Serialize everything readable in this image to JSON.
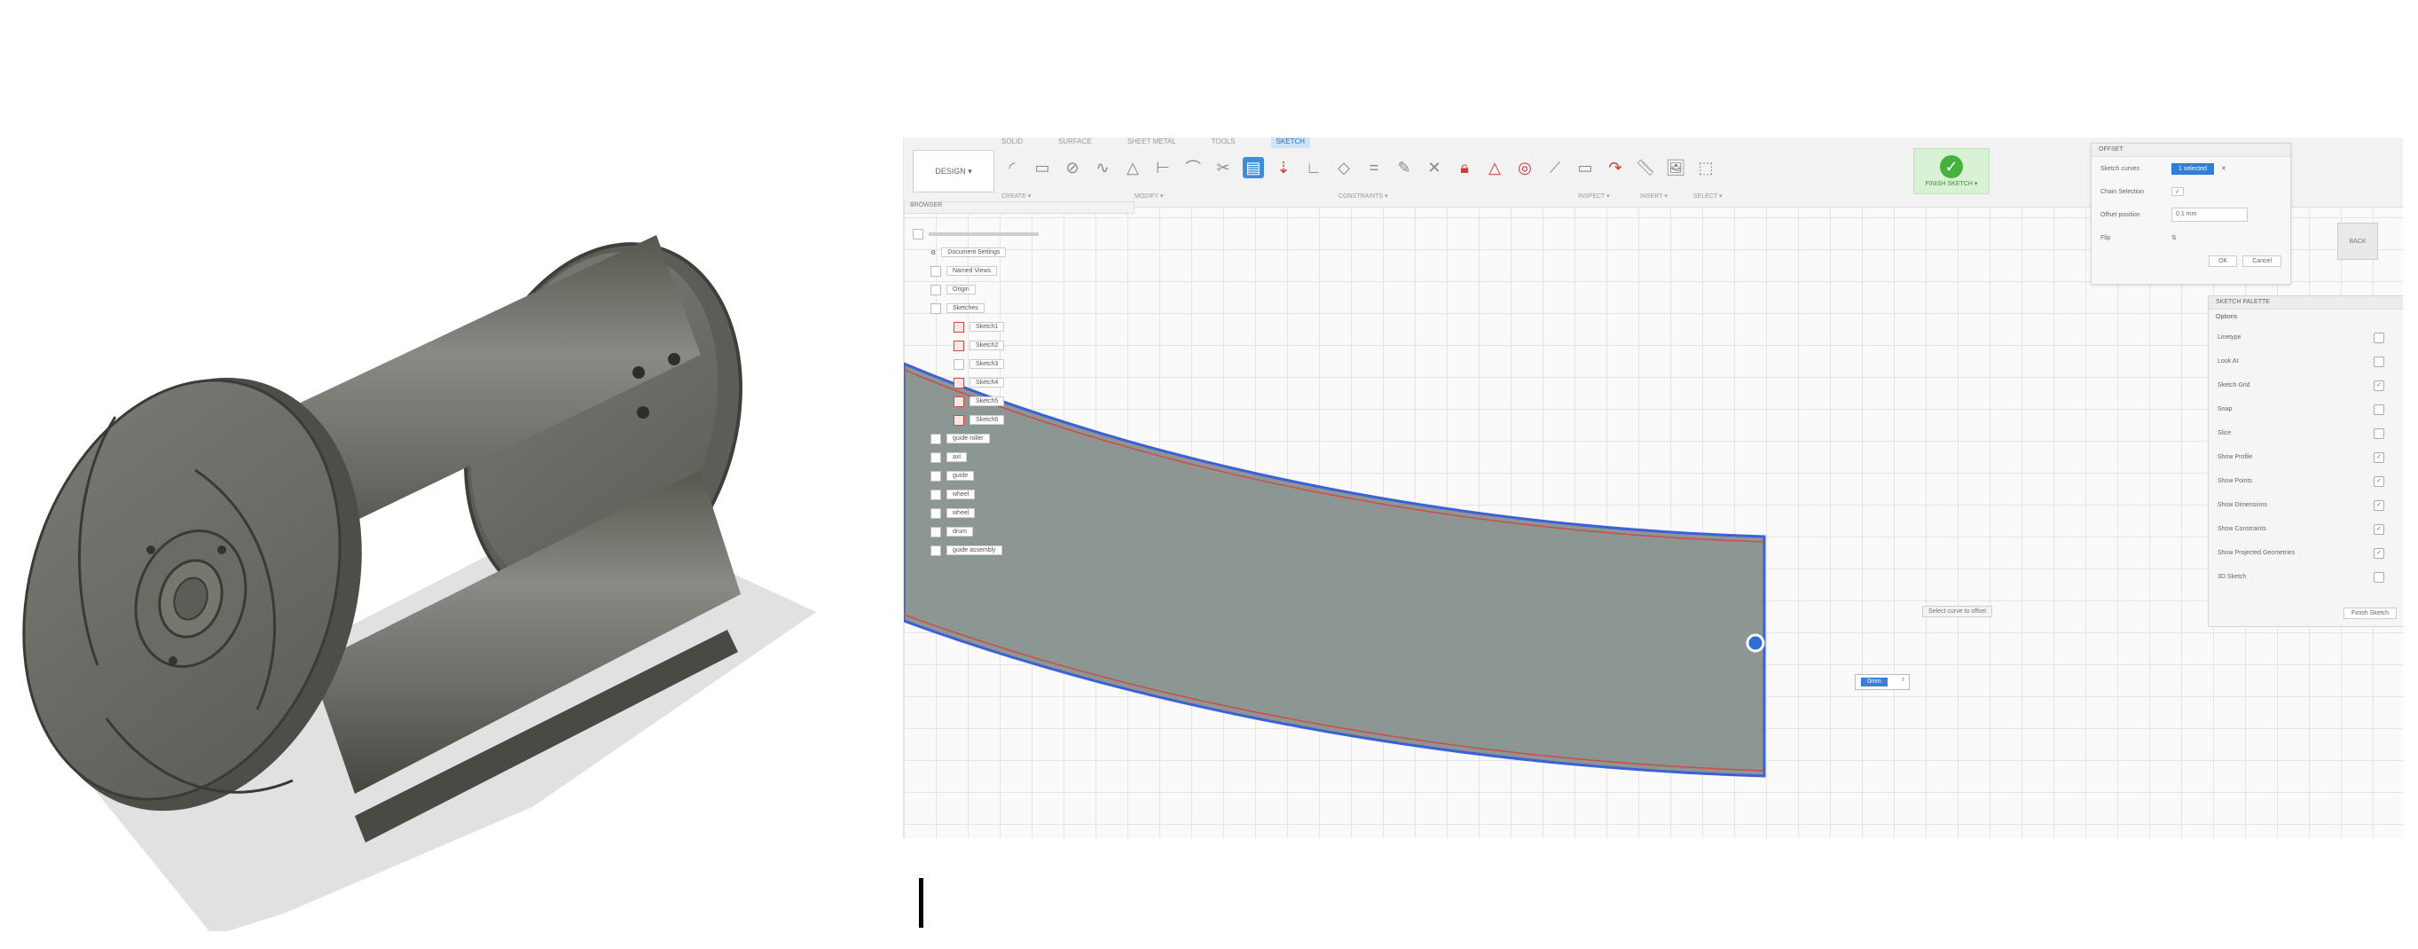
{
  "toolbar": {
    "workspace": "DESIGN ▾",
    "tabs": [
      "SOLID",
      "SURFACE",
      "SHEET METAL",
      "TOOLS",
      "SKETCH"
    ],
    "groups": [
      "CREATE ▾",
      "MODIFY ▾",
      "CONSTRAINTS ▾",
      "INSPECT ▾",
      "INSERT ▾",
      "SELECT ▾",
      "FINISH SKETCH ▾"
    ],
    "finish_label": "FINISH SKETCH ▾"
  },
  "browser": {
    "title": "BROWSER",
    "rows": [
      {
        "label": "",
        "icon": "component-icon"
      },
      {
        "label": "Document Settings",
        "icon": "gear-icon"
      },
      {
        "label": "Named Views",
        "icon": "folder-icon"
      },
      {
        "label": "Origin",
        "icon": "folder-icon"
      },
      {
        "label": "Sketches",
        "icon": "folder-icon"
      },
      {
        "label": "Sketch1",
        "icon": "sketch-icon"
      },
      {
        "label": "Sketch2",
        "icon": "sketch-icon"
      },
      {
        "label": "Sketch3",
        "icon": "sketch-icon"
      },
      {
        "label": "Sketch4",
        "icon": "sketch-icon"
      },
      {
        "label": "Sketch5",
        "icon": "sketch-icon"
      },
      {
        "label": "Sketch6",
        "icon": "sketch-icon"
      },
      {
        "label": "guide roller",
        "icon": "body-icon"
      },
      {
        "label": "axl",
        "icon": "body-icon"
      },
      {
        "label": "guide",
        "icon": "body-icon"
      },
      {
        "label": "wheel",
        "icon": "body-icon"
      },
      {
        "label": "wheel",
        "icon": "body-icon"
      },
      {
        "label": "drum",
        "icon": "body-icon"
      },
      {
        "label": "guide assembly",
        "icon": "body-icon"
      }
    ]
  },
  "offset_dialog": {
    "title": "OFFSET",
    "sketch_curves_label": "Sketch curves",
    "sketch_curves_value": "1 selected",
    "chain_selection_label": "Chain Selection",
    "offset_position_label": "Offset position",
    "offset_position_value": "0.1 mm",
    "flip_label": "Flip",
    "ok": "OK",
    "cancel": "Cancel"
  },
  "viewcube": {
    "label": "BACK"
  },
  "sketch_palette": {
    "title": "SKETCH PALETTE",
    "section": "Options",
    "options": [
      {
        "label": "Linetype",
        "checked": false
      },
      {
        "label": "Look At",
        "checked": false
      },
      {
        "label": "Sketch Grid",
        "checked": true
      },
      {
        "label": "Snap",
        "checked": false
      },
      {
        "label": "Slice",
        "checked": false
      },
      {
        "label": "Show Profile",
        "checked": true
      },
      {
        "label": "Show Points",
        "checked": true
      },
      {
        "label": "Show Dimensions",
        "checked": true
      },
      {
        "label": "Show Constraints",
        "checked": true
      },
      {
        "label": "Show Projected Geometries",
        "checked": true
      },
      {
        "label": "3D Sketch",
        "checked": false
      }
    ],
    "finish": "Finish Sketch"
  },
  "tooltip": "Select curve to offset",
  "dimension_input": "0mm",
  "colors": {
    "accent": "#3c8de0",
    "finish_green": "#45b23c",
    "profile_fill": "#8c9794",
    "profile_edge": "#3d5fd8",
    "model_body": "#6f6e6a"
  }
}
